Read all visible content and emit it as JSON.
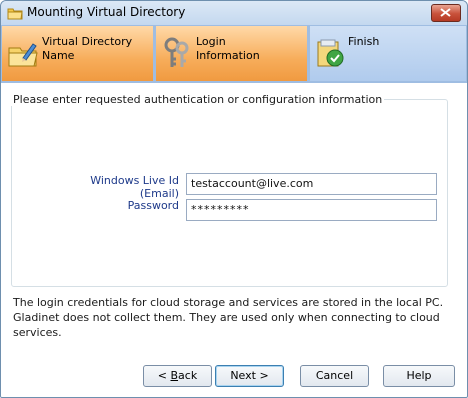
{
  "window": {
    "title": "Mounting Virtual Directory"
  },
  "steps": [
    {
      "label": "Virtual Directory\nName",
      "state": "done"
    },
    {
      "label": "Login\nInformation",
      "state": "current"
    },
    {
      "label": "Finish",
      "state": "pending"
    }
  ],
  "form": {
    "group_title": "Please enter requested authentication or configuration information",
    "email_label": "Windows Live Id (Email)",
    "email_value": "testaccount@live.com",
    "password_label": "Password",
    "password_value": "*********"
  },
  "note": "The login credentials for cloud storage and services are stored in the local PC. Gladinet does not collect them. They are used only when connecting to cloud services.",
  "buttons": {
    "back_prefix": "< ",
    "back_mnemonic": "B",
    "back_rest": "ack",
    "next": "Next >",
    "cancel": "Cancel",
    "help": "Help"
  },
  "colors": {
    "active_step": "#f7ad5b",
    "pending_step": "#b0cbed",
    "title_bar": "#c4d8ef",
    "close_button": "#c8513a"
  }
}
